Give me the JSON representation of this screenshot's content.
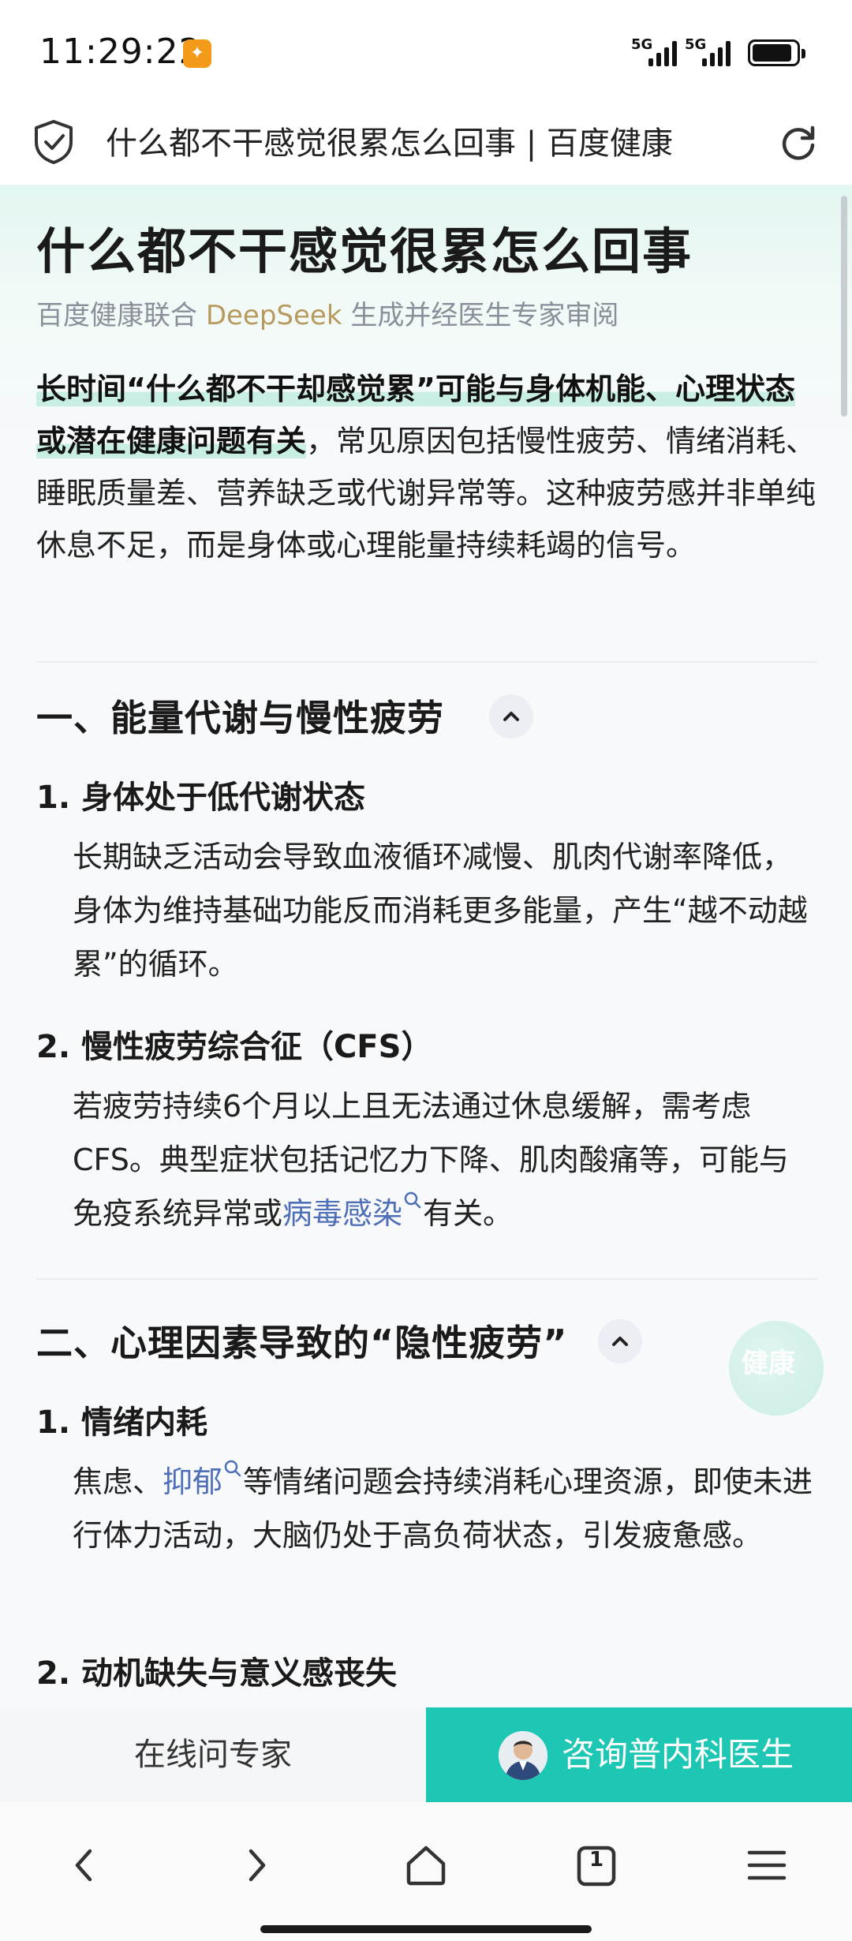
{
  "status_bar": {
    "time": "11:29:22",
    "signal_1": "5G",
    "signal_2": "5G",
    "battery_level": 0.9
  },
  "address_bar": {
    "page_title": "什么都不干感觉很累怎么回事 | 百度健康"
  },
  "article": {
    "title": "什么都不干感觉很累怎么回事",
    "subtitle_prefix": "百度健康联合 ",
    "subtitle_brand": "DeepSeek",
    "subtitle_suffix": " 生成并经医生专家审阅",
    "intro_bold": "长时间“什么都不干却感觉累”可能与身体机能、心理状态或潜在健康问题有关",
    "intro_rest": "，常见原因包括慢性疲劳、情绪消耗、睡眠质量差、营养缺乏或代谢异常等。这种疲劳感并非单纯休息不足，而是身体或心理能量持续耗竭的信号。",
    "sections": [
      {
        "title": "一、能量代谢与慢性疲劳",
        "items": [
          {
            "title": "1. 身体处于低代谢状态",
            "body": "长期缺乏活动会导致血液循环减慢、肌肉代谢率降低，身体为维持基础功能反而消耗更多能量，产生“越不动越累”的循环。"
          },
          {
            "title": "2. 慢性疲劳综合征（CFS）",
            "body_pre": "若疲劳持续6个月以上且无法通过休息缓解，需考虑CFS。典型症状包括记忆力下降、肌肉酸痛等，可能与免疫系统异常或",
            "body_link": "病毒感染",
            "body_post": "有关。"
          }
        ]
      },
      {
        "title": "二、心理因素导致的“隐性疲劳”",
        "items": [
          {
            "title": "1. 情绪内耗",
            "body_pre": "焦虑、",
            "body_link": "抑郁",
            "body_post": "等情绪问题会持续消耗心理资源，即使未进行体力活动，大脑仍处于高负荷状态，引发疲惫感。"
          },
          {
            "title": "2. 动机缺失与意义感丧失"
          }
        ]
      }
    ],
    "float_label": "健康"
  },
  "action_bar": {
    "ask_expert": "在线问专家",
    "consult": "咨询普内科医生"
  },
  "nav_bar": {
    "tab_count": "1"
  },
  "colors": {
    "accent": "#1ec6b4",
    "link": "#4f6fb6",
    "brand_gold": "#b89a5e",
    "highlight": "#c9eee3"
  }
}
